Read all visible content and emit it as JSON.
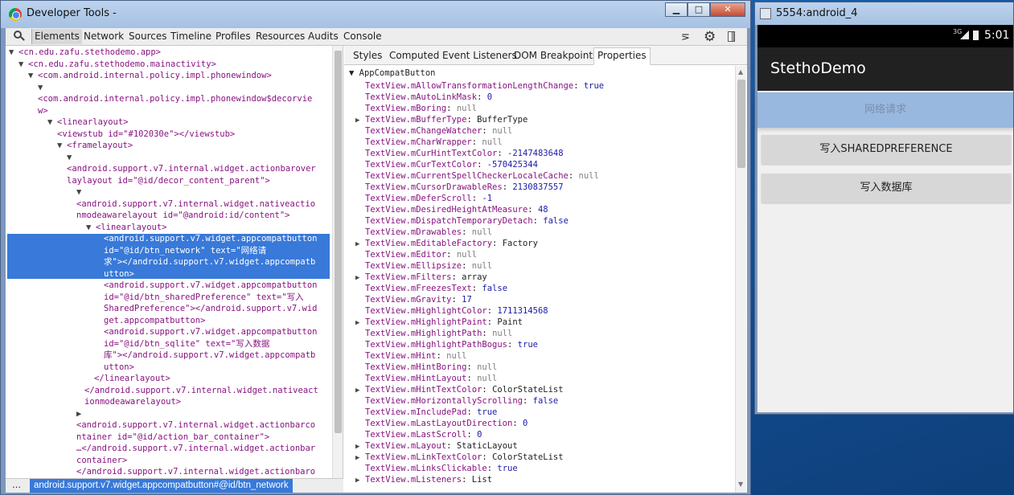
{
  "devtools": {
    "window_title": "Developer Tools -",
    "window_buttons": {
      "minimize": "▁",
      "maximize": "□",
      "close": "✕"
    },
    "toolbar": {
      "search_icon": "search-icon",
      "tabs": [
        "Elements",
        "Network",
        "Sources",
        "Timeline",
        "Profiles",
        "Resources",
        "Audits",
        "Console"
      ],
      "active_tab": "Elements",
      "drawer_icon": "⋝",
      "settings_icon": "⚙"
    },
    "tree_lines": [
      {
        "pre": "▼",
        "t": "<cn.edu.zafu.stethodemo.app>"
      },
      {
        "pre": "▼",
        "t": "<cn.edu.zafu.stethodemo.mainactivity>"
      },
      {
        "pre": "▼",
        "t": "<com.android.internal.policy.impl.phonewindow>"
      },
      {
        "pre": "▼",
        "t": ""
      },
      {
        "pre": "",
        "t": "<com.android.internal.policy.impl.phonewindow$decorvie"
      },
      {
        "pre": "",
        "t": "w>"
      },
      {
        "pre": "▼",
        "t": "<linearlayout>"
      },
      {
        "pre": "",
        "t": "<viewstub id=\"#102030e\"></viewstub>"
      },
      {
        "pre": "▼",
        "t": "<framelayout>"
      },
      {
        "pre": "▼",
        "t": ""
      },
      {
        "pre": "",
        "t": "<android.support.v7.internal.widget.actionbarover"
      },
      {
        "pre": "",
        "t": "laylayout id=\"@id/decor_content_parent\">"
      },
      {
        "pre": "▼",
        "t": ""
      },
      {
        "pre": "",
        "t": "<android.support.v7.internal.widget.nativeactio"
      },
      {
        "pre": "",
        "t": "nmodeawarelayout id=\"@android:id/content\">"
      },
      {
        "pre": "▼",
        "t": "<linearlayout>"
      },
      {
        "pre": "",
        "t": "<android.support.v7.widget.appcompatbutton"
      },
      {
        "pre": "",
        "t": "id=\"@id/btn_network\" text=\"网络请"
      },
      {
        "pre": "",
        "t": "求\"></android.support.v7.widget.appcompatb"
      },
      {
        "pre": "",
        "t": "utton>"
      },
      {
        "pre": "",
        "t": "<android.support.v7.widget.appcompatbutton"
      },
      {
        "pre": "",
        "t": "id=\"@id/btn_sharedPreference\" text=\"写入"
      },
      {
        "pre": "",
        "t": "SharedPreference\"></android.support.v7.wid"
      },
      {
        "pre": "",
        "t": "get.appcompatbutton>"
      },
      {
        "pre": "",
        "t": "<android.support.v7.widget.appcompatbutton"
      },
      {
        "pre": "",
        "t": "id=\"@id/btn_sqlite\" text=\"写入数据"
      },
      {
        "pre": "",
        "t": "库\"></android.support.v7.widget.appcompatb"
      },
      {
        "pre": "",
        "t": "utton>"
      },
      {
        "pre": "",
        "t": "</linearlayout>"
      },
      {
        "pre": "",
        "t": "</android.support.v7.internal.widget.nativeact"
      },
      {
        "pre": "",
        "t": "ionmodeawarelayout>"
      },
      {
        "pre": "▶",
        "t": ""
      },
      {
        "pre": "",
        "t": "<android.support.v7.internal.widget.actionbarco"
      },
      {
        "pre": "",
        "t": "ntainer id=\"@id/action_bar_container\">"
      },
      {
        "pre": "",
        "t": "…</android.support.v7.internal.widget.actionbar"
      },
      {
        "pre": "",
        "t": "container>"
      },
      {
        "pre": "",
        "t": "</android.support.v7.internal.widget.actionbaro"
      }
    ],
    "breadcrumb": {
      "ellipsis": "…",
      "selected": "android.support.v7.widget.appcompatbutton#@id/btn_network"
    },
    "sidebar_tabs": [
      "Styles",
      "Computed",
      "Event Listeners",
      "DOM Breakpoints",
      "Properties"
    ],
    "active_sidebar_tab": "Properties",
    "properties_header": "▼ AppCompatButton",
    "properties": [
      {
        "name": "TextView.mAllowTransformationLengthChange",
        "value": "true",
        "expandable": false
      },
      {
        "name": "TextView.mAutoLinkMask",
        "value": "0",
        "expandable": false
      },
      {
        "name": "TextView.mBoring",
        "value": "null",
        "expandable": false
      },
      {
        "name": "TextView.mBufferType",
        "value": "BufferType",
        "expandable": true
      },
      {
        "name": "TextView.mChangeWatcher",
        "value": "null",
        "expandable": false
      },
      {
        "name": "TextView.mCharWrapper",
        "value": "null",
        "expandable": false
      },
      {
        "name": "TextView.mCurHintTextColor",
        "value": "-2147483648",
        "expandable": false
      },
      {
        "name": "TextView.mCurTextColor",
        "value": "-570425344",
        "expandable": false
      },
      {
        "name": "TextView.mCurrentSpellCheckerLocaleCache",
        "value": "null",
        "expandable": false
      },
      {
        "name": "TextView.mCursorDrawableRes",
        "value": "2130837557",
        "expandable": false
      },
      {
        "name": "TextView.mDeferScroll",
        "value": "-1",
        "expandable": false
      },
      {
        "name": "TextView.mDesiredHeightAtMeasure",
        "value": "48",
        "expandable": false
      },
      {
        "name": "TextView.mDispatchTemporaryDetach",
        "value": "false",
        "expandable": false
      },
      {
        "name": "TextView.mDrawables",
        "value": "null",
        "expandable": false
      },
      {
        "name": "TextView.mEditableFactory",
        "value": "Factory",
        "expandable": true
      },
      {
        "name": "TextView.mEditor",
        "value": "null",
        "expandable": false
      },
      {
        "name": "TextView.mEllipsize",
        "value": "null",
        "expandable": false
      },
      {
        "name": "TextView.mFilters",
        "value": "array",
        "expandable": true
      },
      {
        "name": "TextView.mFreezesText",
        "value": "false",
        "expandable": false
      },
      {
        "name": "TextView.mGravity",
        "value": "17",
        "expandable": false
      },
      {
        "name": "TextView.mHighlightColor",
        "value": "1711314568",
        "expandable": false
      },
      {
        "name": "TextView.mHighlightPaint",
        "value": "Paint",
        "expandable": true
      },
      {
        "name": "TextView.mHighlightPath",
        "value": "null",
        "expandable": false
      },
      {
        "name": "TextView.mHighlightPathBogus",
        "value": "true",
        "expandable": false
      },
      {
        "name": "TextView.mHint",
        "value": "null",
        "expandable": false
      },
      {
        "name": "TextView.mHintBoring",
        "value": "null",
        "expandable": false
      },
      {
        "name": "TextView.mHintLayout",
        "value": "null",
        "expandable": false
      },
      {
        "name": "TextView.mHintTextColor",
        "value": "ColorStateList",
        "expandable": true
      },
      {
        "name": "TextView.mHorizontallyScrolling",
        "value": "false",
        "expandable": false
      },
      {
        "name": "TextView.mIncludePad",
        "value": "true",
        "expandable": false
      },
      {
        "name": "TextView.mLastLayoutDirection",
        "value": "0",
        "expandable": false
      },
      {
        "name": "TextView.mLastScroll",
        "value": "0",
        "expandable": false
      },
      {
        "name": "TextView.mLayout",
        "value": "StaticLayout",
        "expandable": true
      },
      {
        "name": "TextView.mLinkTextColor",
        "value": "ColorStateList",
        "expandable": true
      },
      {
        "name": "TextView.mLinksClickable",
        "value": "true",
        "expandable": false
      },
      {
        "name": "TextView.mListeners",
        "value": "List",
        "expandable": true
      }
    ]
  },
  "emulator": {
    "window_title": "5554:android_4",
    "status_bar": {
      "network": "3G",
      "time": "5:01"
    },
    "app_title": "StethoDemo",
    "buttons": {
      "network": "网络请求",
      "shared": "写入SHAREDPREFERENCE",
      "sqlite": "写入数据库"
    }
  },
  "colors": {
    "selection": "#3879d9",
    "tag": "#881280",
    "attr": "#994500",
    "value": "#1a1aa6",
    "highlight_button": "#98b8e0"
  }
}
